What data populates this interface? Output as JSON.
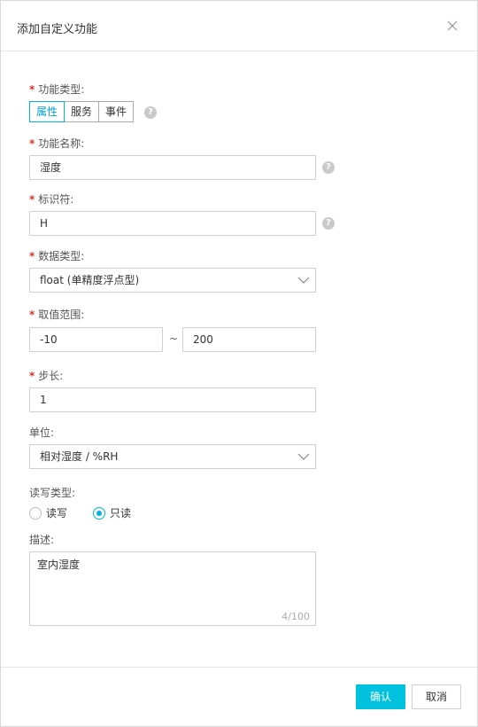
{
  "dialog": {
    "title": "添加自定义功能",
    "close_icon": "close-icon"
  },
  "form": {
    "required_mark": "*",
    "function_type": {
      "label": "功能类型:",
      "options": [
        "属性",
        "服务",
        "事件"
      ],
      "selected": "属性"
    },
    "function_name": {
      "label": "功能名称:",
      "value": "湿度"
    },
    "identifier": {
      "label": "标识符:",
      "value": "H"
    },
    "data_type": {
      "label": "数据类型:",
      "value": "float (单精度浮点型)"
    },
    "value_range": {
      "label": "取值范围:",
      "min": "-10",
      "separator": "~",
      "max": "200"
    },
    "step": {
      "label": "步长:",
      "value": "1"
    },
    "unit": {
      "label": "单位:",
      "value": "相对湿度 / %RH"
    },
    "rw_type": {
      "label": "读写类型:",
      "options": [
        "读写",
        "只读"
      ],
      "selected": "只读"
    },
    "description": {
      "label": "描述:",
      "value": "室内湿度",
      "counter": "4/100"
    }
  },
  "footer": {
    "confirm_label": "确认",
    "cancel_label": "取消"
  },
  "colors": {
    "accent": "#00c1de",
    "required": "#d93026"
  }
}
